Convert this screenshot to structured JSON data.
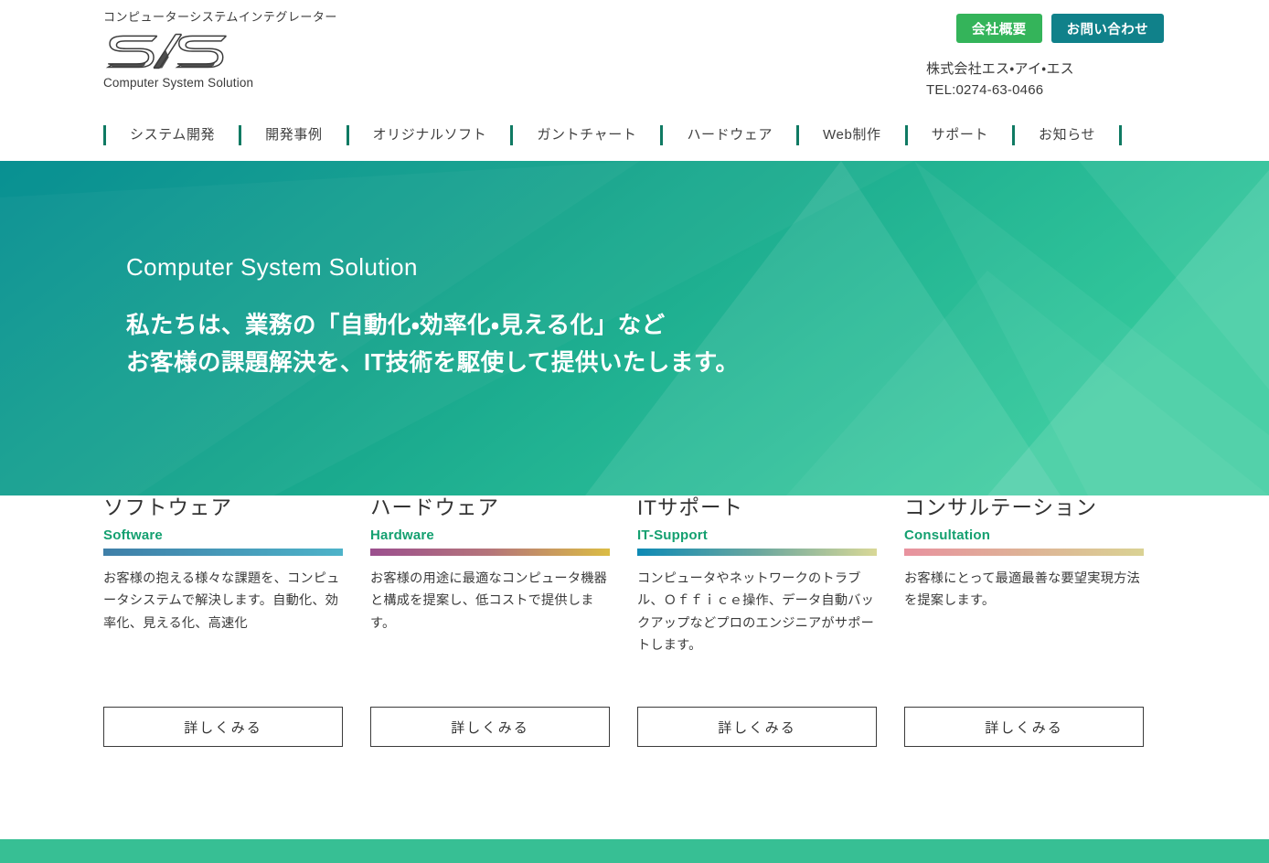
{
  "header": {
    "tagline": "コンピューターシステムインテグレーター",
    "logo_text": "S/S",
    "logo_sub": "Computer System Solution",
    "company_button": "会社概要",
    "contact_button": "お問い合わせ",
    "company_name": "株式会社エス・アイ・エス",
    "telephone": "TEL:0274-63-0466"
  },
  "nav": {
    "items": [
      {
        "label": "システム開発"
      },
      {
        "label": "開発事例"
      },
      {
        "label": "オリジナルソフト"
      },
      {
        "label": "ガントチャート"
      },
      {
        "label": "ハードウェア"
      },
      {
        "label": "Web制作"
      },
      {
        "label": "サポート"
      },
      {
        "label": "お知らせ"
      }
    ]
  },
  "hero": {
    "title": "Computer System Solution",
    "line1": "私たちは、業務の「自動化・効率化・見える化」など",
    "line2": "お客様の課題解決を、IT技術を駆使して提供いたします。",
    "gradient_start": "#048f8f",
    "gradient_end": "#33c89c"
  },
  "cards": [
    {
      "title": "ソフトウェア",
      "subtitle": "Software",
      "bar_from": "#3f7fa8",
      "bar_to": "#4db3c9",
      "desc": "お客様の抱える様々な課題を、コンピュータシステムで解決します。自動化、効率化、見える化、高速化",
      "button": "詳しくみる"
    },
    {
      "title": "ハードウェア",
      "subtitle": "Hardware",
      "bar_from": "#9b4f8e",
      "bar_to": "#dbbc44",
      "desc": "お客様の用途に最適なコンピュータ機器と構成を提案し、低コストで提供します。",
      "button": "詳しくみる"
    },
    {
      "title": "ITサポート",
      "subtitle": "IT-Support",
      "bar_from": "#0e8ab5",
      "bar_to": "#d9d897",
      "desc": "コンピュータやネットワークのトラブル、Ｏｆｆｉｃｅ操作、データ自動バックアップなどプロのエンジニアがサポートします。",
      "button": "詳しくみる"
    },
    {
      "title": "コンサルテーション",
      "subtitle": "Consultation",
      "bar_from": "#e8929f",
      "bar_to": "#dad294",
      "desc": "お客様にとって最適最善な要望実現方法を提案します。",
      "button": "詳しくみる"
    }
  ],
  "footer": {
    "bar_color": "#37bf94"
  }
}
